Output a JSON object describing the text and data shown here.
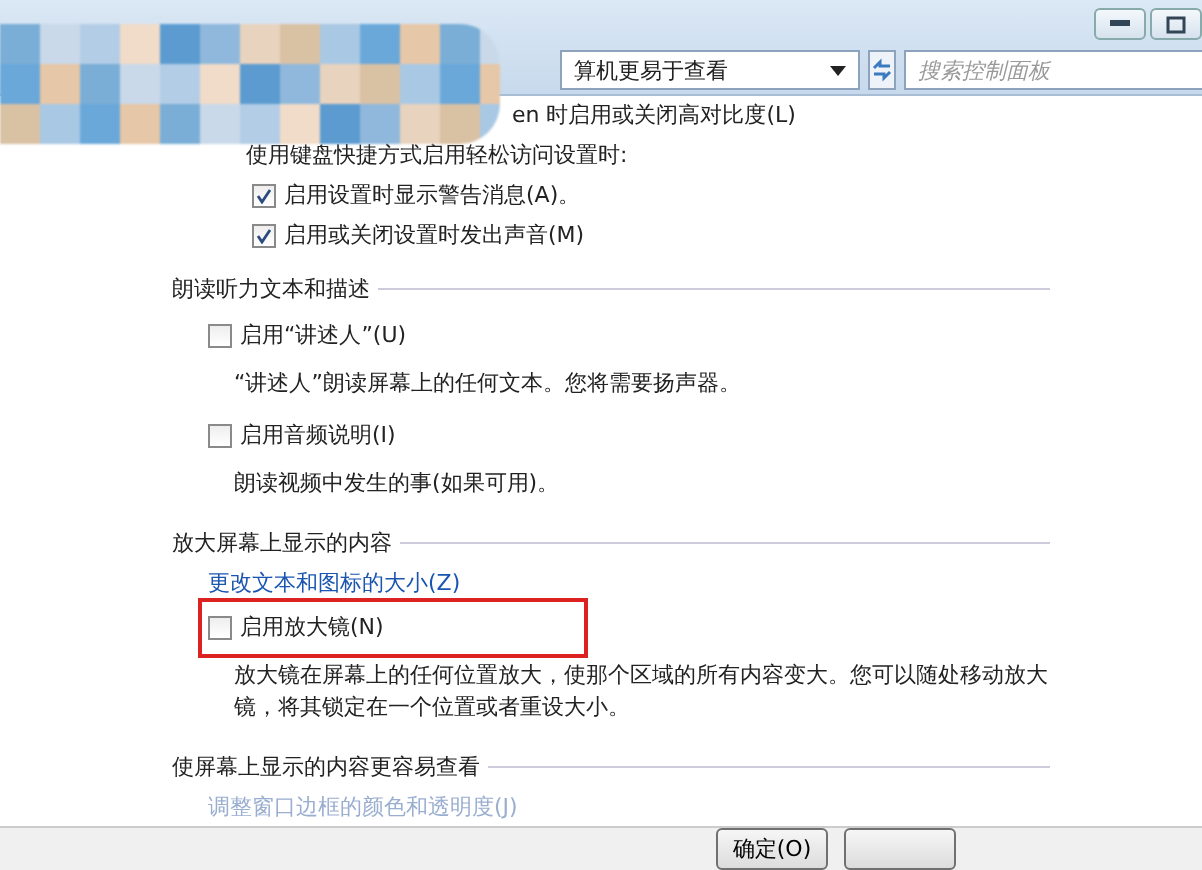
{
  "window": {
    "address": "算机更易于查看",
    "search": {
      "placeholder": "搜索控制面板"
    }
  },
  "sections": [
    {
      "items": [
        {
          "kind": "text",
          "text": "en 时启用或关闭高对比度(L)"
        },
        {
          "kind": "text",
          "text": "使用键盘快捷方式启用轻松访问设置时:",
          "children": [
            {
              "label": "启用设置时显示警告消息(A)。",
              "checked": true
            },
            {
              "label": "启用或关闭设置时发出声音(M)",
              "checked": true
            }
          ]
        }
      ]
    },
    {
      "title": "朗读听力文本和描述",
      "items": [
        {
          "kind": "checkbox",
          "label": "启用“讲述人”(U)",
          "checked": false,
          "highlighted": false
        },
        {
          "kind": "description",
          "text": "“讲述人”朗读屏幕上的任何文本。您将需要扬声器。"
        },
        {
          "kind": "checkbox",
          "label": "启用音频说明(I)",
          "checked": false,
          "highlighted": false
        },
        {
          "kind": "description",
          "text": "朗读视频中发生的事(如果可用)。"
        }
      ]
    },
    {
      "title": "放大屏幕上显示的内容",
      "items": [
        {
          "kind": "link",
          "text": "更改文本和图标的大小(Z)",
          "disabled": false
        },
        {
          "kind": "checkbox",
          "label": "启用放大镜(N)",
          "checked": false,
          "highlighted": true
        },
        {
          "kind": "description",
          "text": "放大镜在屏幕上的任何位置放大，使那个区域的所有内容变大。您可以随处移动放大镜，将其锁定在一个位置或者重设大小。"
        }
      ]
    },
    {
      "title": "使屏幕上显示的内容更容易查看",
      "items": [
        {
          "kind": "link",
          "text": "调整窗口边框的颜色和透明度(J)",
          "disabled": true
        }
      ]
    }
  ],
  "buttons": [
    "确定(O)"
  ]
}
